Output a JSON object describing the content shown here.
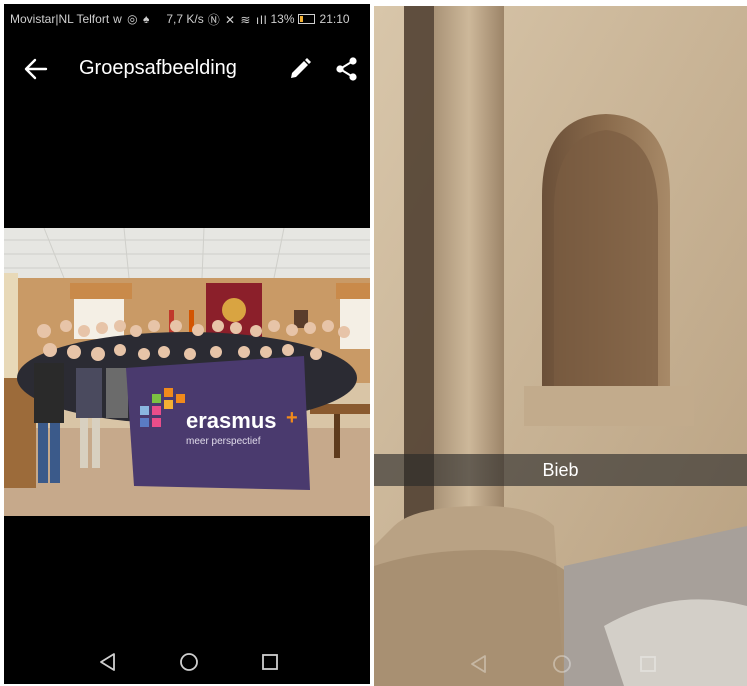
{
  "status_bar": {
    "carrier": "Movistar|NL Telfort",
    "net_speed": "7,7 K/s",
    "battery_pct": "13%",
    "time": "21:10"
  },
  "app_bar": {
    "title": "Groepsafbeelding",
    "back_icon": "arrow-left-icon",
    "edit_icon": "pencil-icon",
    "share_icon": "share-icon"
  },
  "photo": {
    "banner_brand": "erasmus",
    "banner_plus": "+",
    "banner_tagline": "meer perspectief"
  },
  "caption": {
    "text": "Bieb"
  },
  "nav": {
    "back_icon": "triangle-back-icon",
    "home_icon": "circle-home-icon",
    "recents_icon": "square-recents-icon"
  },
  "colors": {
    "banner_purple": "#4a3a6e",
    "banner_orange": "#f08a1c",
    "stone_wall": "#c9b497"
  }
}
